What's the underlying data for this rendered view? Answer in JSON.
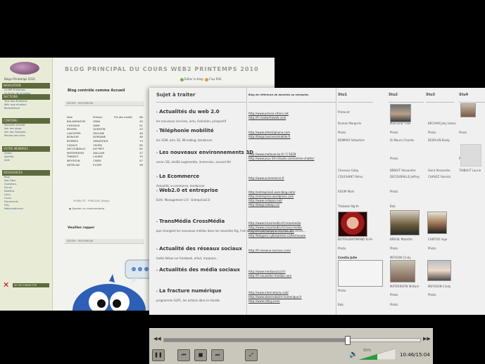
{
  "blog": {
    "site_name": "Blogs Printemps 2010",
    "sidebar_sections": [
      {
        "header": "NAVIGATION",
        "links": [
          "Le NW Printemps",
          "Le forum de la classe"
        ]
      },
      {
        "header": "SECTIONS",
        "links": [
          "Tous des étudiants",
          "Wiki rose étudiant",
          "Bibliothèque"
        ]
      },
      {
        "header": "CONTENU",
        "links": [
          "Nouvelle activité",
          "Voir des blogs",
          "Voir des Podcasts",
          "Rendez des sites"
        ]
      },
      {
        "header": "VOTRE MEMBRES",
        "links": [
          "Statut",
          "Agenda",
          "Aide"
        ]
      },
      {
        "header": "RESSOURCES",
        "links": [
          "Blog",
          "Nos Sites",
          "Questions",
          "Forum",
          "Modèles",
          "Liens",
          "Cours",
          "Documents",
          "FAQ",
          "Webconférence"
        ]
      }
    ],
    "sidebar_footer": "SE DÉCONNECTER",
    "title": "BLOG PRINCIPAL DU COURS WEB2 PRINTEMPS 2010",
    "edit_links": [
      "Éditer le blog",
      "Flux RSS"
    ],
    "subtitle": "Blog contrôlé comme Accueil",
    "table_header": "ÉDITER · RECHERCHE",
    "table_cols": [
      "Nom",
      "Prénom",
      "Fils des modifs",
      "Nb"
    ],
    "students": [
      [
        "BALAMANCHE",
        "YANA",
        "40"
      ],
      [
        "CHEVAUX",
        "SABY",
        "51"
      ],
      [
        "MOMMI",
        "QUENTIN",
        "53"
      ],
      [
        "LAVOSPER",
        "PAOLINE",
        "48"
      ],
      [
        "BONOUR",
        "BORVANE",
        "46"
      ],
      [
        "BOMMOI",
        "SEBASTIEN",
        "73"
      ],
      [
        "CAZALS",
        "VIVIEN",
        "65"
      ],
      [
        "DECOUBAILLE",
        "JOFFREY",
        "62"
      ],
      [
        "MATERREFIN",
        "WILLIAM",
        "47"
      ],
      [
        "THIBAUT",
        "LAURIE",
        "70"
      ],
      [
        "MEYSSON",
        "CINDY",
        "57"
      ],
      [
        "DESPLAN",
        "ELODY",
        "58"
      ]
    ],
    "visibility": "VISIBILITÉ : PUBLIQUE (blogs)",
    "add_comment": "Ajouter un commentaire",
    "follow": "Veuillez rapper",
    "second_table_header": "ÉDITER · RECHERCHE"
  },
  "sheet": {
    "col_topic": "Sujet à traiter",
    "col_links": "Blog de référence de données ou exemples",
    "col_students": [
      "Stu1",
      "Stu2",
      "Stu3",
      "Stu4"
    ],
    "topics": [
      {
        "title": "Actualités du web 2.0",
        "desc": "les nouveaux services, actu, évolution, prospectif",
        "links": [
          "http://www.presse-citron.net",
          "http://fr.readwriteweb.com"
        ]
      },
      {
        "title": "Téléphonie mobilité",
        "desc": "Iso 3GM, actu 3G, Microblog, tendances",
        "links": [
          "http://www.zdnet/iphone.com",
          "http://blogs.businessmobile.fr"
        ]
      },
      {
        "title": "Les nouveaux environnements 3D",
        "desc": "secon 3D, réalité augmentée, immersion, second life",
        "links": [
          "http://www.metaversia.fr/ ?/ 5628",
          "http://www.jeux-3d-virtuels.com/online-chatter"
        ]
      },
      {
        "title": "Le Ecommerce",
        "desc": "Actualité, e-commerce, tendances",
        "links": [
          "http://www.ecommerce.fr"
        ]
      },
      {
        "title": "Web2.0 et entreprise",
        "desc": "Enth. Management 2.0 : Entreprise2.0",
        "links": [
          "http://entreprise2.over-blog.com/",
          "http://entreprise.wordpress.com",
          "http://www.cellepro.net/",
          "http://blogs.bebop.ca/"
        ]
      },
      {
        "title": "TransMédia CrossMédia",
        "desc": "que changent les nouveaux médias dans les nouvelles ttg, l'oin de nouvelles fiictions, les fins, les séries...",
        "links": [
          "http://www.transmedia.fr/crossmedia",
          "http://www.crossmedia.fr/cross-media",
          "http://fr.wiktionary.fr/transmedia",
          "http://blogues.cyberpresse.ca/technaute"
        ]
      },
      {
        "title": "Actualité des réseaux sociaux",
        "desc": "hadio follow sur facebook, orkut, myspace...",
        "links": [
          "http://fr.reseaux-sociaux.com/"
        ]
      },
      {
        "title": "Actualités des média sociaux",
        "desc": "",
        "links": [
          "http://www.mediasocial.fr/",
          "http://fr.nouvelles-medias.com"
        ]
      },
      {
        "title": "La fracture numérique",
        "desc": "programme GLPC, les actions dans le monde",
        "links": [
          "http://www.internetactu.net/",
          "http://www.observatoire-numerique.fr",
          "http://www.ctboy.com/"
        ]
      }
    ],
    "students": [
      "Protocat",
      "Dumas Margerie",
      "Mancarat Yves",
      "BECHAN Jahy tuteur",
      "Photo",
      "Photo",
      "Photo",
      "Photo",
      "BOMMOI Sébastien",
      "Di Mauro Charles",
      "DESPLAN Elody",
      "Photo",
      "Photo",
      "Chevaux Gaby",
      "BENOIT Alexandre",
      "Saint Alexandre",
      "THIBAUT Laurie",
      "COUCHANT Rémy",
      "DECOUBAILLE Jeffrey",
      "CHAVEZ Yannick",
      "ROUM Mark",
      "Photo",
      "Thobatel Ng-Ye",
      "Bob",
      "BOTRAUENTIMAND Yo-Ye",
      "BREUIL Mazette",
      "CANTOO Inge",
      "Photo",
      "Photo",
      "Photo",
      "Crestia Julie",
      "MEYSON Cindy",
      "MATERREFIN William",
      "MEYSSON Cindy",
      "Photo",
      "Photo",
      "Photo",
      "Bob",
      "Photo"
    ]
  },
  "player": {
    "volume_label": "50%",
    "time": "10:46/15:04",
    "progress": 0.7138,
    "volume": 0.5
  }
}
